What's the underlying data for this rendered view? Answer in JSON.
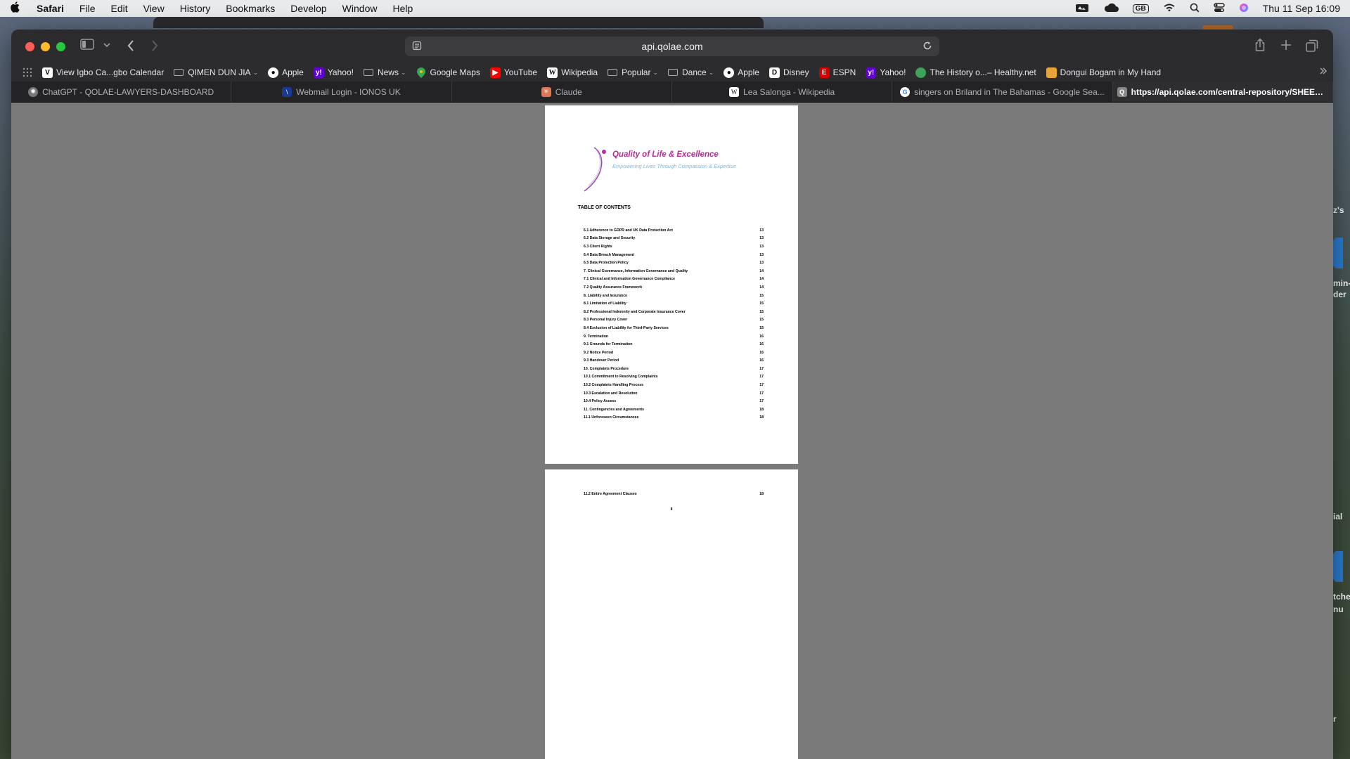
{
  "menubar": {
    "app": "Safari",
    "items": [
      "File",
      "Edit",
      "View",
      "History",
      "Bookmarks",
      "Develop",
      "Window",
      "Help"
    ],
    "input_source": "GB",
    "datetime": "Thu 11 Sep  16:09"
  },
  "toolbar": {
    "url": "api.qolae.com"
  },
  "bookmarks": [
    {
      "label": "View Igbo Ca...gbo Calendar",
      "kind": "site",
      "color": "#ffffff"
    },
    {
      "label": "QIMEN DUN JIA",
      "kind": "folder"
    },
    {
      "label": "Apple",
      "kind": "site",
      "color": "#ffffff"
    },
    {
      "label": "Yahoo!",
      "kind": "site",
      "color": "#6001d2"
    },
    {
      "label": "News",
      "kind": "folder"
    },
    {
      "label": "Google Maps",
      "kind": "site",
      "color": "#34a853"
    },
    {
      "label": "YouTube",
      "kind": "site",
      "color": "#ff0000"
    },
    {
      "label": "Wikipedia",
      "kind": "site",
      "color": "#ffffff"
    },
    {
      "label": "Popular",
      "kind": "folder"
    },
    {
      "label": "Dance",
      "kind": "folder"
    },
    {
      "label": "Apple",
      "kind": "site",
      "color": "#ffffff"
    },
    {
      "label": "Disney",
      "kind": "site",
      "color": "#ffffff"
    },
    {
      "label": "ESPN",
      "kind": "site",
      "color": "#d00000"
    },
    {
      "label": "Yahoo!",
      "kind": "site",
      "color": "#6001d2"
    },
    {
      "label": "The History o...– Healthy.net",
      "kind": "site",
      "color": "#3fa35a"
    },
    {
      "label": "Dongui Bogam in My Hand",
      "kind": "site",
      "color": "#e8a43a"
    }
  ],
  "tabs": [
    {
      "label": "ChatGPT - QOLAE-LAWYERS-DASHBOARD",
      "color": "#888888"
    },
    {
      "label": "Webmail Login - IONOS UK",
      "color": "#1b3a8f"
    },
    {
      "label": "Claude",
      "color": "#d97757"
    },
    {
      "label": "Lea Salonga - Wikipedia",
      "color": "#ffffff"
    },
    {
      "label": "singers on Briland  in The Bahamas - Google Sea...",
      "color": "#ffffff"
    },
    {
      "label": "https://api.qolae.com/central-repository/SHEET_...",
      "color": "#888888"
    }
  ],
  "document": {
    "logo_title": "Quality of Life & Excellence",
    "logo_tagline": "Empowering Lives Through Compassion & Expertise",
    "toc_heading": "TABLE OF CONTENTS",
    "toc": [
      {
        "title": "6.1 Adherence to GDPR and UK Data Protection Act",
        "page": "13"
      },
      {
        "title": "6.2 Data Storage and Security",
        "page": "13"
      },
      {
        "title": "6.3 Client Rights",
        "page": "13"
      },
      {
        "title": "6.4 Data Breach Management",
        "page": "13"
      },
      {
        "title": "6.5 Data Protection Policy",
        "page": "13"
      },
      {
        "title": "7. Clinical Governance, Information Governance and Quality",
        "page": "14"
      },
      {
        "title": "7.1 Clinical and Information Governance Compliance",
        "page": "14"
      },
      {
        "title": "7.2 Quality Assurance Framework",
        "page": "14"
      },
      {
        "title": "8. Liability and Insurance",
        "page": "15"
      },
      {
        "title": "8.1 Limitation of Liability",
        "page": "15"
      },
      {
        "title": "8.2 Professional Indemnity and Corporate Insurance Cover",
        "page": "15"
      },
      {
        "title": "8.3 Personal Injury Cover",
        "page": "15"
      },
      {
        "title": "8.4 Exclusion of Liability for Third-Party Services",
        "page": "15"
      },
      {
        "title": "9. Termination",
        "page": "16"
      },
      {
        "title": "9.1 Grounds for Termination",
        "page": "16"
      },
      {
        "title": "9.2 Notice Period",
        "page": "16"
      },
      {
        "title": "9.3 Handover Period",
        "page": "16"
      },
      {
        "title": "10. Complaints Procedure",
        "page": "17"
      },
      {
        "title": "10.1 Commitment to Resolving Complaints",
        "page": "17"
      },
      {
        "title": "10.2 Complaints Handling Process",
        "page": "17"
      },
      {
        "title": "10.3 Escalation and Resolution",
        "page": "17"
      },
      {
        "title": "10.4 Policy Access",
        "page": "17"
      },
      {
        "title": "11. Contingencies and Agreements",
        "page": "18"
      },
      {
        "title": "11.1 Unforeseen Circumstances",
        "page": "18"
      }
    ],
    "page2_entry": {
      "title": "11.2 Entire Agreement Clauses",
      "page": "18"
    },
    "page2_number": "8"
  },
  "background_snippets": [
    "z's",
    "min-",
    "der",
    "ial",
    "tche",
    "nu",
    "r"
  ]
}
